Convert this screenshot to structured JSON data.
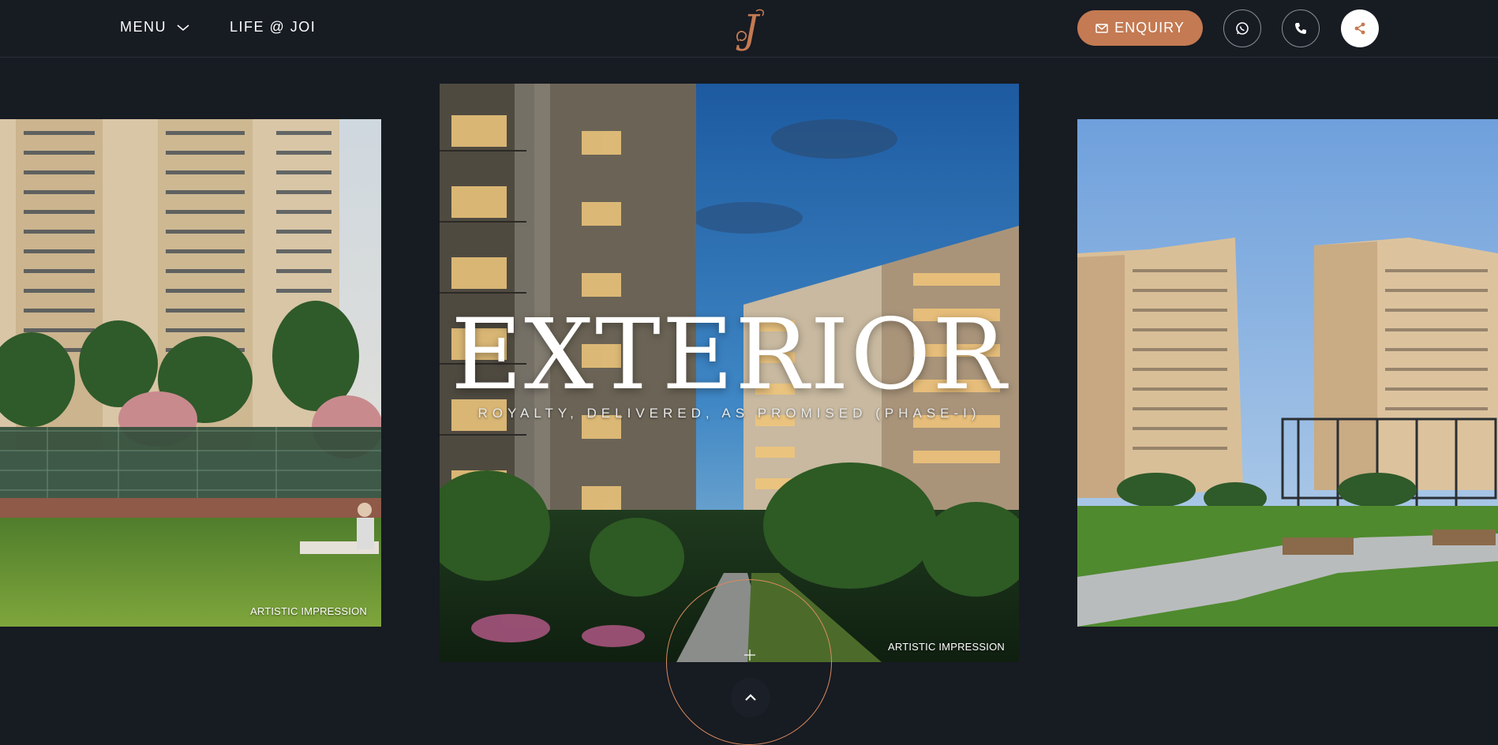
{
  "header": {
    "menu_label": "MENU",
    "nav_link": "LIFE @ JOI",
    "logo_letter": "J",
    "enquiry_label": "ENQUIRY",
    "icons": {
      "menu": "chevron-down-icon",
      "enquiry": "envelope-icon",
      "whatsapp": "whatsapp-icon",
      "phone": "phone-icon",
      "share": "share-icon"
    },
    "accent_color": "#c47a52"
  },
  "hero": {
    "title": "EXTERIOR",
    "subtitle": "ROYALTY, DELIVERED, AS PROMISED (PHASE-I)"
  },
  "slides": {
    "left_caption": "ARTISTIC IMPRESSION",
    "center_caption": "ARTISTIC IMPRESSION"
  },
  "controls": {
    "scroll_up_icon": "chevron-up-icon",
    "plus_icon": "plus-icon"
  }
}
